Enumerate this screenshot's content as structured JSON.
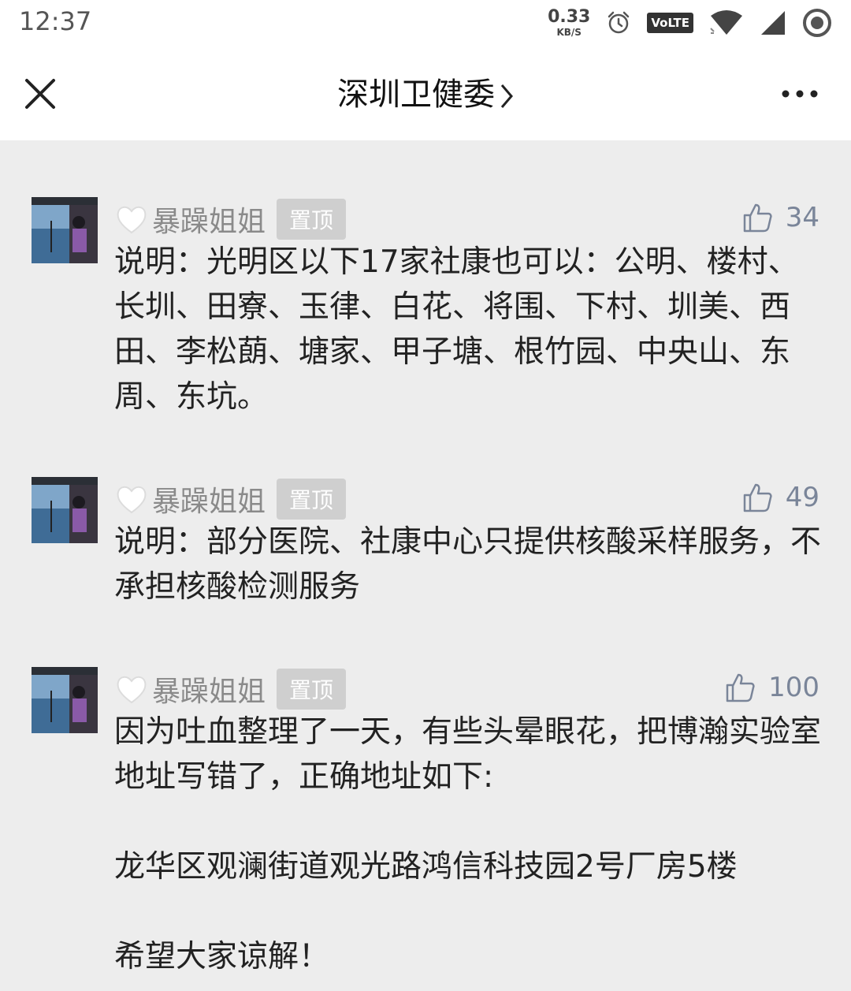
{
  "status_bar": {
    "time": "12:37",
    "speed_value": "0.33",
    "speed_unit": "KB/S",
    "volte": "VoLTE"
  },
  "nav": {
    "title": "深圳卫健委"
  },
  "comments": [
    {
      "author": "暴躁姐姐",
      "pin_label": "置顶",
      "likes": "34",
      "text": "说明：光明区以下17家社康也可以：公明、楼村、长圳、田寮、玉律、白花、将围、下村、圳美、西田、李松蓢、塘家、甲子塘、根竹园、中央山、东周、东坑。"
    },
    {
      "author": "暴躁姐姐",
      "pin_label": "置顶",
      "likes": "49",
      "text": "说明：部分医院、社康中心只提供核酸采样服务，不承担核酸检测服务"
    },
    {
      "author": "暴躁姐姐",
      "pin_label": "置顶",
      "likes": "100",
      "text": "因为吐血整理了一天，有些头晕眼花，把博瀚实验室地址写错了，正确地址如下:\n\n龙华区观澜街道观光路鸿信科技园2号厂房5楼\n\n希望大家谅解！"
    }
  ],
  "colors": {
    "background": "#ededed",
    "author": "#8a8a8a",
    "pin_badge": "#cfcfcf",
    "likes": "#7a8599"
  }
}
